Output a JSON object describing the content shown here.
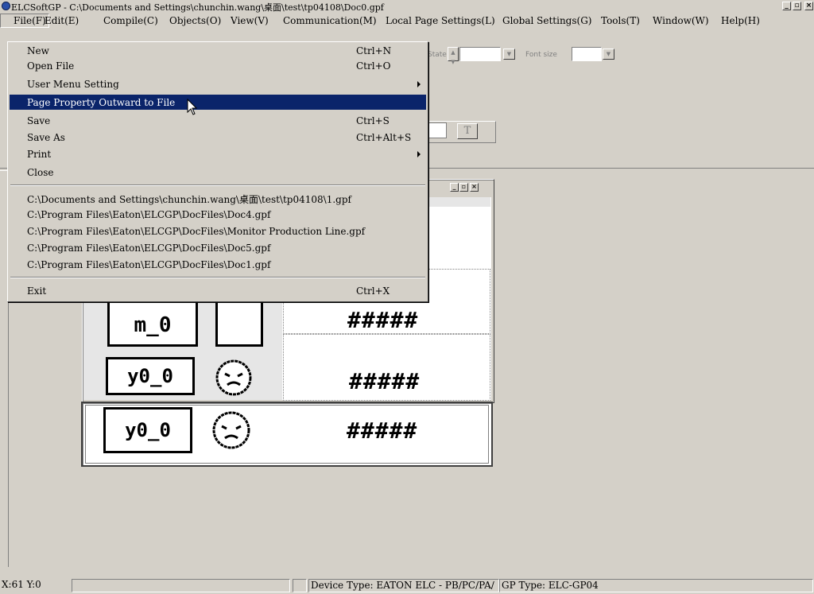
{
  "title": "ELCSoftGP - C:\\Documents and Settings\\chunchin.wang\\桌面\\test\\tp04108\\Doc0.gpf",
  "window_controls": {
    "minimize": "_",
    "maximize": "▫",
    "close": "×"
  },
  "menubar": [
    "File(F)",
    "Edit(E)",
    "Compile(C)",
    "Objects(O)",
    "View(V)",
    "Communication(M)",
    "Local Page Settings(L)",
    "Global Settings(G)",
    "Tools(T)",
    "Window(W)",
    "Help(H)"
  ],
  "toolbar": {
    "state_label": "State",
    "font_size_label": "Font size",
    "text_button": "T"
  },
  "file_menu": {
    "items": [
      {
        "label": "New",
        "accel": "Ctrl+N"
      },
      {
        "label": "Open File",
        "accel": "Ctrl+O"
      },
      {
        "label": "User Menu Setting",
        "accel": ""
      },
      {
        "label": "Page Property Outward to File",
        "accel": ""
      },
      {
        "label": "Save",
        "accel": "Ctrl+S"
      },
      {
        "label": "Save As",
        "accel": "Ctrl+Alt+S"
      },
      {
        "label": "Print",
        "accel": ""
      },
      {
        "label": "Close",
        "accel": ""
      }
    ],
    "recent": [
      "C:\\Documents and Settings\\chunchin.wang\\桌面\\test\\tp04108\\1.gpf",
      "C:\\Program Files\\Eaton\\ELCGP\\DocFiles\\Doc4.gpf",
      "C:\\Program Files\\Eaton\\ELCGP\\DocFiles\\Monitor Production Line.gpf",
      "C:\\Program Files\\Eaton\\ELCGP\\DocFiles\\Doc5.gpf",
      "C:\\Program Files\\Eaton\\ELCGP\\DocFiles\\Doc1.gpf"
    ],
    "exit": {
      "label": "Exit",
      "accel": "Ctrl+X"
    }
  },
  "preview": {
    "row1": {
      "tag": "m_0",
      "value": "#####"
    },
    "row2": {
      "tag": "y0_0",
      "value": "#####"
    },
    "row3": {
      "tag": "y0_0",
      "value": "#####"
    }
  },
  "statusbar": {
    "coords": "X:61 Y:0",
    "device_type": "Device Type: EATON ELC - PB/PC/PA/",
    "gp_type": "GP Type: ELC-GP04"
  }
}
